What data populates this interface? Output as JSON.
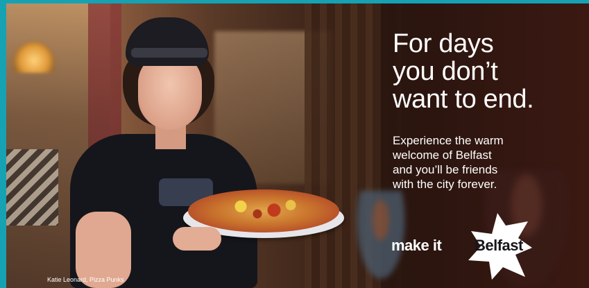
{
  "headline": {
    "line1": "For days",
    "line2": "you don’t",
    "line3": "want to end."
  },
  "body": {
    "line1": "Experience the warm",
    "line2": "welcome of Belfast",
    "line3": "and you’ll be friends",
    "line4": "with the city forever."
  },
  "logo": {
    "make_it": "make it",
    "belfast": "Belfast",
    "burst_color": "#ffffff"
  },
  "credit": "Katie Leonard, Pizza Punks",
  "colors": {
    "frame": "#16a2b3",
    "text": "#ffffff"
  }
}
